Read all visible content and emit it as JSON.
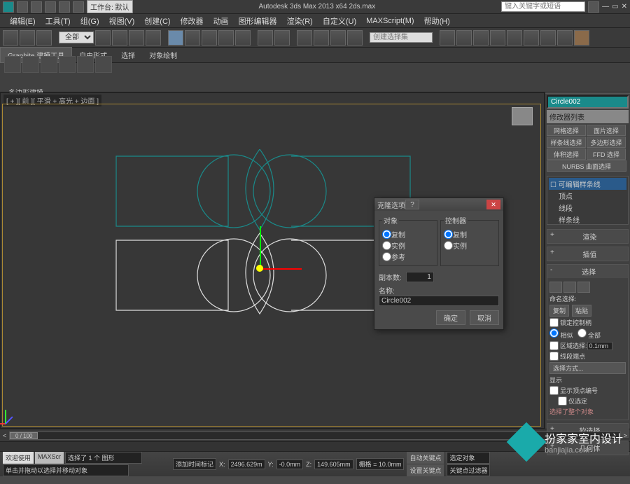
{
  "title": "Autodesk 3ds Max  2013 x64     2ds.max",
  "search_placeholder": "键入关键字或短语",
  "quickbar": {
    "workspace_label": "工作台: 默认"
  },
  "menus": [
    "编辑(E)",
    "工具(T)",
    "组(G)",
    "视图(V)",
    "创建(C)",
    "修改器",
    "动画",
    "图形编辑器",
    "渲染(R)",
    "自定义(U)",
    "MAXScript(M)",
    "帮助(H)"
  ],
  "selection_set_ph": "创建选择集",
  "main_toolbar_select": "全部",
  "ribbon_tabs": [
    "Graphite 建模工具",
    "自由形式",
    "选择",
    "对象绘制"
  ],
  "polymod_label": "多边形建模",
  "viewport_label": "[ + ][ 前 ][ 平滑 + 高光 + 边面 ]",
  "dialog": {
    "title": "克隆选项",
    "group_object": "对象",
    "group_controller": "控制器",
    "opt_copy": "复制",
    "opt_instance": "实例",
    "opt_reference": "参考",
    "copies_label": "副本数:",
    "copies_value": "1",
    "name_label": "名称:",
    "name_value": "Circle002",
    "btn_ok": "确定",
    "btn_cancel": "取消"
  },
  "cmd": {
    "obj_name": "Circle002",
    "modlist": "修改器列表",
    "btns": [
      "网格选择",
      "面片选择",
      "样条线选择",
      "多边形选择",
      "体积选择",
      "FFD 选择",
      "NURBS 曲面选择"
    ],
    "stack_title": "可编辑样条线",
    "stack_items": [
      "顶点",
      "线段",
      "样条线"
    ],
    "roll_sel_title": "选择",
    "roll_render": "渲染",
    "roll_interp": "插值",
    "named_sel": "命名选择:",
    "btn_copy": "复制",
    "btn_paste": "粘贴",
    "lock_handles": "锁定控制柄",
    "opt_similar": "相似",
    "opt_all": "全部",
    "area_sel": "区域选择:",
    "area_val": "0.1mm",
    "seg_end": "线段端点",
    "sel_method": "选择方式...",
    "display": "显示",
    "show_vnum": "显示顶点编号",
    "only_sel": "仅选定",
    "sel_status": "选择了整个对象",
    "soft_sel": "软选择",
    "geometry": "几何体"
  },
  "timeline": {
    "frame": "0 / 100",
    "start": "0",
    "end": "100"
  },
  "status": {
    "welcome": "欢迎使用",
    "script": "MAXScr",
    "sel": "选择了 1 个 图形",
    "hint": "单击并拖动以选择并移动对象",
    "add_time_tag": "添加时间标记",
    "x": "2496.629m",
    "y": "-0.0mm",
    "z": "149.605mm",
    "grid": "栅格 = 10.0mm",
    "autokey": "自动关键点",
    "selkey": "选定对象",
    "setkey": "设置关键点",
    "keyfilter": "关键点过滤器"
  },
  "watermark": {
    "brand": "扮家家室内设计",
    "url": "banjiajia.com"
  }
}
